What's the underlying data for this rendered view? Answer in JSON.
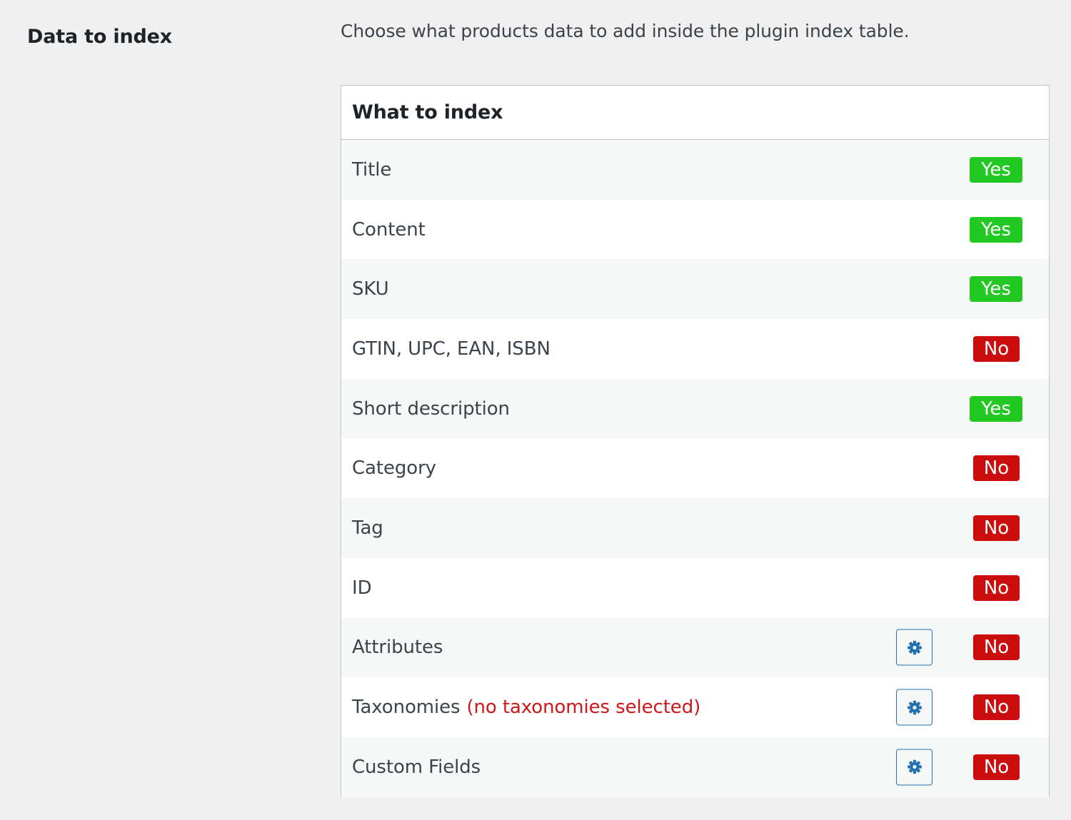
{
  "setting": {
    "label": "Data to index",
    "description": "Choose what products data to add inside the plugin index table."
  },
  "table": {
    "header": "What to index",
    "rows": [
      {
        "label": "Title",
        "note": "",
        "has_settings": false,
        "status": "Yes"
      },
      {
        "label": "Content",
        "note": "",
        "has_settings": false,
        "status": "Yes"
      },
      {
        "label": "SKU",
        "note": "",
        "has_settings": false,
        "status": "Yes"
      },
      {
        "label": "GTIN, UPC, EAN, ISBN",
        "note": "",
        "has_settings": false,
        "status": "No"
      },
      {
        "label": "Short description",
        "note": "",
        "has_settings": false,
        "status": "Yes"
      },
      {
        "label": "Category",
        "note": "",
        "has_settings": false,
        "status": "No"
      },
      {
        "label": "Tag",
        "note": "",
        "has_settings": false,
        "status": "No"
      },
      {
        "label": "ID",
        "note": "",
        "has_settings": false,
        "status": "No"
      },
      {
        "label": "Attributes",
        "note": "",
        "has_settings": true,
        "status": "No"
      },
      {
        "label": "Taxonomies",
        "note": "(no taxonomies selected)",
        "has_settings": true,
        "status": "No"
      },
      {
        "label": "Custom Fields",
        "note": "",
        "has_settings": true,
        "status": "No"
      }
    ]
  },
  "colors": {
    "yes_badge": "#22c922",
    "no_badge": "#cc0d0d",
    "note_text": "#cc1818",
    "gear_accent": "#2271b1"
  },
  "icons": {
    "settings_button": "gear-icon"
  }
}
